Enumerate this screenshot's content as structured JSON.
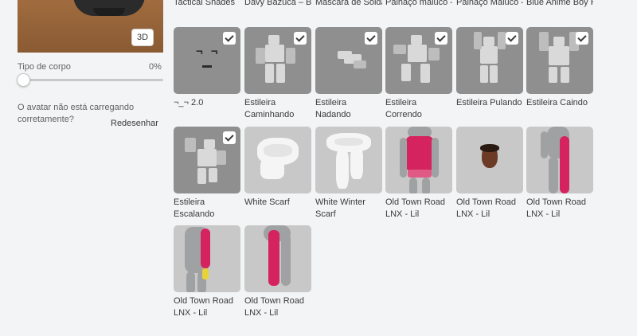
{
  "left_panel": {
    "view_toggle": "3D",
    "body_type_label": "Tipo de corpo",
    "body_type_value": "0%",
    "not_loading_text": "O avatar não está carregando corretamente?",
    "redraw_label": "Redesenhar"
  },
  "top_row": [
    "Tactical Shades",
    "Davy Bazuca – Bazuca",
    "Máscara de Soldador",
    "Palhaço maluco –",
    "Palhaço Maluco –",
    "Blue Anime Boy Hair"
  ],
  "items": [
    {
      "label": "¬_¬ 2.0",
      "selected": true
    },
    {
      "label": "Estileira Caminhando",
      "selected": true
    },
    {
      "label": "Estileira Nadando",
      "selected": true
    },
    {
      "label": "Estileira Correndo",
      "selected": true
    },
    {
      "label": "Estileira Pulando",
      "selected": true
    },
    {
      "label": "Estileira Caindo",
      "selected": true
    },
    {
      "label": "Estileira Escalando",
      "selected": true
    },
    {
      "label": "White Scarf",
      "selected": false
    },
    {
      "label": "White Winter Scarf",
      "selected": false
    },
    {
      "label": "Old Town Road LNX - Lil",
      "selected": false
    },
    {
      "label": "Old Town Road LNX - Lil",
      "selected": false
    },
    {
      "label": "Old Town Road LNX - Lil",
      "selected": false
    },
    {
      "label": "Old Town Road LNX - Lil",
      "selected": false
    },
    {
      "label": "Old Town Road LNX - Lil",
      "selected": false
    }
  ],
  "face_glyph": "¬ ¬",
  "colors": {
    "background": "#f2f4f5",
    "tile_gray": "#8f8f8f",
    "tile_light": "#c8c8c8",
    "accent_red": "#d5235f"
  }
}
